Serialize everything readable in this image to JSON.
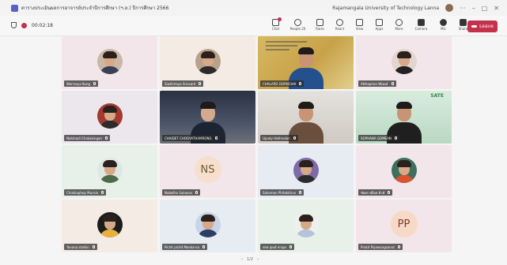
{
  "window": {
    "title": "ตารางประเมินผลการอาจารย์ประจำปีการศึกษา (ฯ.ล.) ปีการศึกษา 2566",
    "org": "Rajamangala University of Technology Lanna",
    "min": "–",
    "restore": "□",
    "close": "✕"
  },
  "meeting": {
    "timer": "00:02:18"
  },
  "toolbar": {
    "chat": "Chat",
    "people": "People",
    "people_count": "20",
    "raise": "Raise",
    "react": "React",
    "view": "View",
    "apps": "Apps",
    "more": "More",
    "camera": "Camera",
    "mic": "Mic",
    "share": "Share",
    "leave": "Leave"
  },
  "participants": [
    {
      "name": "Worrasya Kung"
    },
    {
      "name": "Siwitchaya Srisaard"
    },
    {
      "name": "CHALARD DORNCHAI"
    },
    {
      "name": "Atthapiron Wiwat"
    },
    {
      "name": "Natshadi Chakakingon"
    },
    {
      "name": "CHAIDET CHOOVATHAMRONG"
    },
    {
      "name": "Upady Hathnalan"
    },
    {
      "name": "SOPHANA GOMEAN"
    },
    {
      "name": "Chakkaphop Munsin"
    },
    {
      "name": "Nabatha Sukasan"
    },
    {
      "name": "Sakamon Phitakkhun"
    },
    {
      "name": "ชัยพร ฟล็อท ติวฟ์"
    },
    {
      "name": "Yavana stalkin"
    },
    {
      "name": "Pichit pichit Manka-na"
    },
    {
      "name": "พรพ สุดเย้ ชาญพ"
    },
    {
      "name": "Prakit Piyawongsanut"
    }
  ],
  "initials": {
    "ns": "NS",
    "pp": "PP"
  },
  "slide": {
    "logo": "SATE"
  },
  "pager": {
    "prev": "‹",
    "page": "1/2",
    "next": "›"
  },
  "colors": {
    "accent": "#5b5fc7",
    "leave": "#c4314b"
  }
}
